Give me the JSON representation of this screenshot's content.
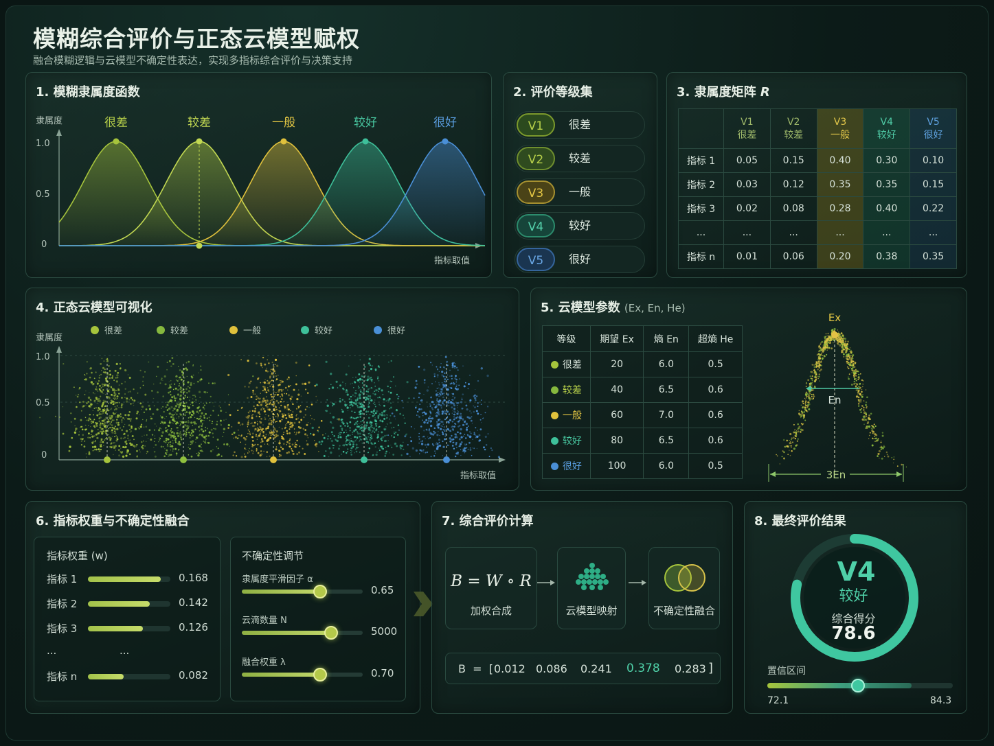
{
  "header": {
    "title": "模糊综合评价与正态云模型赋权",
    "subtitle": "融合模糊逻辑与云模型不确定性表达，实现多指标综合评价与决策支持"
  },
  "colors": {
    "very_poor": "#a6c43c",
    "poor": "#86b83e",
    "fair": "#e0c13c",
    "good": "#3ec09a",
    "very_good": "#4a8fd6",
    "accent": "#3fc7a0"
  },
  "panel1": {
    "title": "1. 模糊隶属度函数",
    "ylabel": "隶属度",
    "xlabel": "指标取值",
    "yticks": [
      "1.0",
      "0.5",
      "0"
    ],
    "curves": [
      "很差",
      "较差",
      "一般",
      "较好",
      "很好"
    ]
  },
  "panel2": {
    "title": "2. 评价等级集",
    "grades": [
      {
        "code": "V1",
        "label": "很差"
      },
      {
        "code": "V2",
        "label": "较差"
      },
      {
        "code": "V3",
        "label": "一般"
      },
      {
        "code": "V4",
        "label": "较好"
      },
      {
        "code": "V5",
        "label": "很好"
      }
    ]
  },
  "panel3": {
    "title": "3. 隶属度矩阵",
    "title_symbol": "R",
    "columns": [
      {
        "code": "V1",
        "label": "很差"
      },
      {
        "code": "V2",
        "label": "较差"
      },
      {
        "code": "V3",
        "label": "一般"
      },
      {
        "code": "V4",
        "label": "较好"
      },
      {
        "code": "V5",
        "label": "很好"
      }
    ],
    "rows": [
      {
        "name": "指标 1",
        "values": [
          "0.05",
          "0.15",
          "0.40",
          "0.30",
          "0.10"
        ]
      },
      {
        "name": "指标 2",
        "values": [
          "0.03",
          "0.12",
          "0.35",
          "0.35",
          "0.15"
        ]
      },
      {
        "name": "指标 3",
        "values": [
          "0.02",
          "0.08",
          "0.28",
          "0.40",
          "0.22"
        ]
      },
      {
        "name": "...",
        "values": [
          "...",
          "...",
          "...",
          "...",
          "..."
        ]
      },
      {
        "name": "指标 n",
        "values": [
          "0.01",
          "0.06",
          "0.20",
          "0.38",
          "0.35"
        ]
      }
    ]
  },
  "panel4": {
    "title": "4. 正态云模型可视化",
    "ylabel": "隶属度",
    "xlabel": "指标取值",
    "yticks": [
      "1.0",
      "0.5",
      "0"
    ],
    "legend": [
      "很差",
      "较差",
      "一般",
      "较好",
      "很好"
    ]
  },
  "panel5": {
    "title": "5. 云模型参数",
    "title_note": "(Ex, En, He)",
    "headers": [
      "等级",
      "期望 Ex",
      "熵 En",
      "超熵 He"
    ],
    "rows": [
      {
        "grade": "很差",
        "ex": "20",
        "en": "6.0",
        "he": "0.5"
      },
      {
        "grade": "较差",
        "ex": "40",
        "en": "6.5",
        "he": "0.6"
      },
      {
        "grade": "一般",
        "ex": "60",
        "en": "7.0",
        "he": "0.6"
      },
      {
        "grade": "较好",
        "ex": "80",
        "en": "6.5",
        "he": "0.6"
      },
      {
        "grade": "很好",
        "ex": "100",
        "en": "6.0",
        "he": "0.5"
      }
    ],
    "diagram": {
      "ex": "Ex",
      "en": "En",
      "three_en": "3En"
    }
  },
  "panel6": {
    "title": "6. 指标权重与不确定性融合",
    "weights_title": "指标权重 (w)",
    "weights": [
      {
        "name": "指标 1",
        "value": "0.168",
        "fill": 0.168
      },
      {
        "name": "指标 2",
        "value": "0.142",
        "fill": 0.142
      },
      {
        "name": "指标 3",
        "value": "0.126",
        "fill": 0.126
      },
      {
        "name": "...",
        "value": "...",
        "fill": 0
      },
      {
        "name": "指标 n",
        "value": "0.082",
        "fill": 0.082
      }
    ],
    "adjust_title": "不确定性调节",
    "sliders": [
      {
        "label": "隶属度平滑因子 α",
        "value": "0.65",
        "level": 0.65
      },
      {
        "label": "云滴数量 N",
        "value": "5000",
        "level": 0.74
      },
      {
        "label": "融合权重 λ",
        "value": "0.70",
        "level": 0.65
      }
    ]
  },
  "panel7": {
    "title": "7. 综合评价计算",
    "formula": "B = W ∘ R",
    "steps": [
      "加权合成",
      "云模型映射",
      "不确定性融合"
    ],
    "result_prefix": "B  =  [",
    "result_values": [
      "0.012",
      "0.086",
      "0.241",
      "0.378",
      "0.283"
    ],
    "result_suffix": "]"
  },
  "panel8": {
    "title": "8. 最终评价结果",
    "grade_code": "V4",
    "grade_label": "较好",
    "score_label": "综合得分",
    "score": "78.6",
    "score_fraction": 0.786,
    "ci_label": "置信区间",
    "ci_low": "72.1",
    "ci_high": "84.3"
  }
}
